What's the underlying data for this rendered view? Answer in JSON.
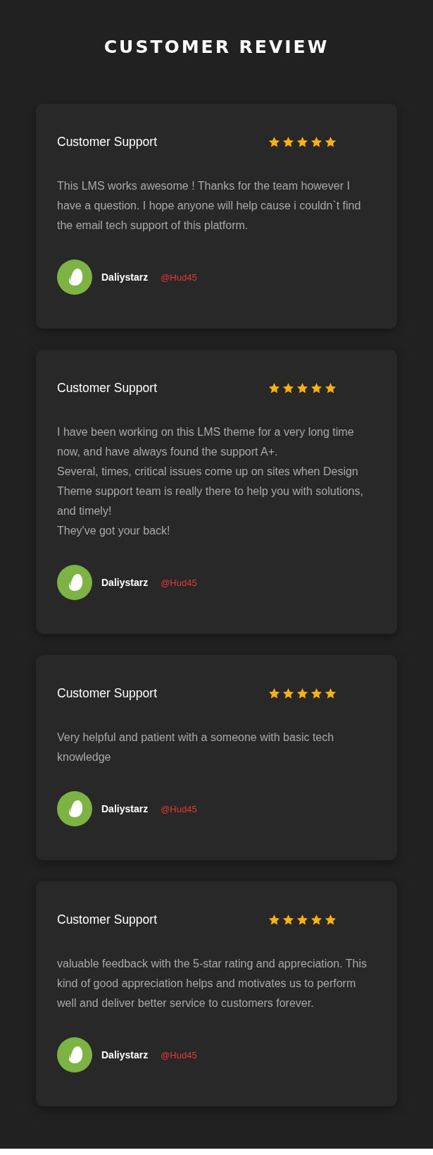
{
  "title": "CUSTOMER REVIEW",
  "reviews": [
    {
      "heading": "Customer Support",
      "stars": 5,
      "text": "This LMS works awesome ! Thanks for the team however I have a question. I hope anyone will help cause i couldn`t find the email tech support of this platform.",
      "author": "Daliystarz",
      "handle": "@Hud45"
    },
    {
      "heading": "Customer Support",
      "stars": 5,
      "text": "I have been working on this LMS theme for a very long time now, and have always found the support A+.\nSeveral, times, critical issues come up on sites when Design Theme support team is really there to help you with solutions, and timely!\nThey've got your back!",
      "author": "Daliystarz",
      "handle": "@Hud45"
    },
    {
      "heading": "Customer Support",
      "stars": 5,
      "text": "Very helpful and patient with a someone with basic tech knowledge",
      "author": "Daliystarz",
      "handle": "@Hud45"
    },
    {
      "heading": "Customer Support",
      "stars": 5,
      "text": "valuable feedback with the 5-star rating and appreciation. This kind of good appreciation helps and motivates us to perform well and deliver better service to customers forever.",
      "author": "Daliystarz",
      "handle": "@Hud45"
    }
  ]
}
